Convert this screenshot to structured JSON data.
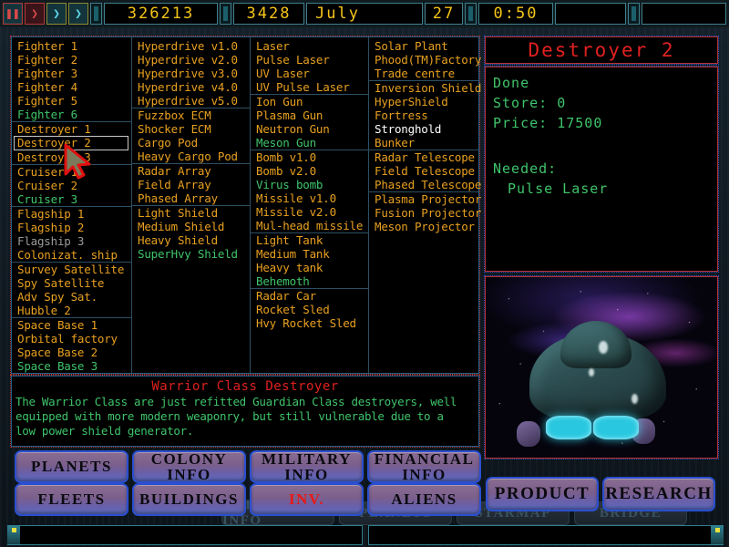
{
  "topbar": {
    "controls": [
      {
        "name": "pause-button",
        "glyph": "❚❚",
        "style": "ctl-pause"
      },
      {
        "name": "play-button",
        "glyph": "❯",
        "style": "ctl-play"
      },
      {
        "name": "fast-forward-button",
        "glyph": "❯",
        "style": "ctl-ff"
      },
      {
        "name": "fastest-forward-button",
        "glyph": "❯",
        "style": "ctl-ff"
      }
    ],
    "money": "326213",
    "research": "3428",
    "month": "July",
    "day": "27",
    "time": "0:50"
  },
  "inventory": {
    "columns": [
      {
        "name": "ships",
        "items": [
          {
            "label": "Fighter 1",
            "state": "available"
          },
          {
            "label": "Fighter 2",
            "state": "available"
          },
          {
            "label": "Fighter 3",
            "state": "available"
          },
          {
            "label": "Fighter 4",
            "state": "available"
          },
          {
            "label": "Fighter 5",
            "state": "available"
          },
          {
            "label": "Fighter 6",
            "state": "new"
          },
          {
            "label": "Destroyer 1",
            "state": "available",
            "group_start": true
          },
          {
            "label": "Destroyer 2",
            "state": "available",
            "selected": true
          },
          {
            "label": "Destroyer 3",
            "state": "available"
          },
          {
            "label": "Cruiser 1",
            "state": "available",
            "group_start": true
          },
          {
            "label": "Cruiser 2",
            "state": "available"
          },
          {
            "label": "Cruiser 3",
            "state": "new"
          },
          {
            "label": "Flagship 1",
            "state": "available",
            "group_start": true
          },
          {
            "label": "Flagship 2",
            "state": "available"
          },
          {
            "label": "Flagship 3",
            "state": "locked"
          },
          {
            "label": "Colonizat. ship",
            "state": "available"
          },
          {
            "label": "Survey Satellite",
            "state": "available",
            "group_start": true
          },
          {
            "label": "Spy Satellite",
            "state": "available"
          },
          {
            "label": "Adv Spy Sat.",
            "state": "available"
          },
          {
            "label": "Hubble 2",
            "state": "available"
          },
          {
            "label": "Space Base 1",
            "state": "available",
            "group_start": true
          },
          {
            "label": "Orbital factory",
            "state": "available"
          },
          {
            "label": "Space Base 2",
            "state": "available"
          },
          {
            "label": "Space Base 3",
            "state": "new"
          }
        ]
      },
      {
        "name": "ship-systems",
        "items": [
          {
            "label": "Hyperdrive v1.0",
            "state": "available"
          },
          {
            "label": "Hyperdrive v2.0",
            "state": "available"
          },
          {
            "label": "Hyperdrive v3.0",
            "state": "available"
          },
          {
            "label": "Hyperdrive v4.0",
            "state": "available"
          },
          {
            "label": "Hyperdrive v5.0",
            "state": "available"
          },
          {
            "label": "Fuzzbox ECM",
            "state": "available",
            "group_start": true
          },
          {
            "label": "Shocker ECM",
            "state": "available"
          },
          {
            "label": "Cargo Pod",
            "state": "available"
          },
          {
            "label": "Heavy Cargo Pod",
            "state": "available"
          },
          {
            "label": "Radar Array",
            "state": "available",
            "group_start": true
          },
          {
            "label": "Field Array",
            "state": "available"
          },
          {
            "label": "Phased Array",
            "state": "available"
          },
          {
            "label": "Light Shield",
            "state": "available",
            "group_start": true
          },
          {
            "label": "Medium Shield",
            "state": "available"
          },
          {
            "label": "Heavy Shield",
            "state": "available"
          },
          {
            "label": "SuperHvy Shield",
            "state": "new"
          }
        ]
      },
      {
        "name": "weapons",
        "items": [
          {
            "label": "Laser",
            "state": "available"
          },
          {
            "label": "Pulse Laser",
            "state": "available"
          },
          {
            "label": "UV Laser",
            "state": "available"
          },
          {
            "label": "UV Pulse Laser",
            "state": "available"
          },
          {
            "label": "Ion Gun",
            "state": "available",
            "group_start": true
          },
          {
            "label": "Plasma Gun",
            "state": "available"
          },
          {
            "label": "Neutron Gun",
            "state": "available"
          },
          {
            "label": "Meson Gun",
            "state": "new"
          },
          {
            "label": "Bomb v1.0",
            "state": "available",
            "group_start": true
          },
          {
            "label": "Bomb v2.0",
            "state": "available"
          },
          {
            "label": "Virus bomb",
            "state": "new"
          },
          {
            "label": "Missile v1.0",
            "state": "available"
          },
          {
            "label": "Missile v2.0",
            "state": "available"
          },
          {
            "label": "Mul-head missile",
            "state": "available"
          },
          {
            "label": "Light Tank",
            "state": "available",
            "group_start": true
          },
          {
            "label": "Medium Tank",
            "state": "available"
          },
          {
            "label": "Heavy tank",
            "state": "available"
          },
          {
            "label": "Behemoth",
            "state": "new"
          },
          {
            "label": "Radar Car",
            "state": "available",
            "group_start": true
          },
          {
            "label": "Rocket Sled",
            "state": "available"
          },
          {
            "label": "Hvy Rocket Sled",
            "state": "available"
          }
        ]
      },
      {
        "name": "buildings",
        "items": [
          {
            "label": "Solar Plant",
            "state": "available"
          },
          {
            "label": "Phood(TM)Factory",
            "state": "available"
          },
          {
            "label": "Trade centre",
            "state": "available"
          },
          {
            "label": "Inversion Shield",
            "state": "available",
            "group_start": true
          },
          {
            "label": "HyperShield",
            "state": "available"
          },
          {
            "label": "Fortress",
            "state": "available"
          },
          {
            "label": "Stronghold",
            "state": "highlighted"
          },
          {
            "label": "Bunker",
            "state": "available"
          },
          {
            "label": "Radar Telescope",
            "state": "available",
            "group_start": true
          },
          {
            "label": "Field Telescope",
            "state": "available"
          },
          {
            "label": "Phased Telescope",
            "state": "available"
          },
          {
            "label": "Plasma Projector",
            "state": "available",
            "group_start": true
          },
          {
            "label": "Fusion Projector",
            "state": "available"
          },
          {
            "label": "Meson Projector",
            "state": "available"
          }
        ]
      }
    ]
  },
  "description": {
    "title": "Warrior Class Destroyer",
    "line1": "The Warrior Class are just refitted Guardian Class destroyers, well",
    "line2": "equipped with more modern weaponry, but still vulnerable due to a",
    "line3": "low power shield generator."
  },
  "detail": {
    "title": "Destroyer 2",
    "status": "Done",
    "store": "Store: 0",
    "price": "Price: 17500",
    "needed_label": "Needed:",
    "needed_item": "Pulse Laser"
  },
  "nav": {
    "row1": [
      {
        "name": "planets-button",
        "label": "PLANETS",
        "label2": ""
      },
      {
        "name": "colony-info-button",
        "label": "COLONY",
        "label2": "INFO"
      },
      {
        "name": "military-info-button",
        "label": "MILITARY",
        "label2": "INFO"
      },
      {
        "name": "financial-info-button",
        "label": "FINANCIAL",
        "label2": "INFO"
      }
    ],
    "row2": [
      {
        "name": "fleets-button",
        "label": "FLEETS",
        "label2": ""
      },
      {
        "name": "buildings-button",
        "label": "BUILDINGS",
        "label2": ""
      },
      {
        "name": "inventory-button",
        "label": "INV.",
        "label2": "",
        "active": true
      },
      {
        "name": "aliens-button",
        "label": "ALIENS",
        "label2": ""
      }
    ],
    "right": [
      {
        "name": "product-button",
        "label": "PRODUCT"
      },
      {
        "name": "research-button",
        "label": "RESEARCH"
      }
    ],
    "background_row": [
      {
        "name": "bg-colony-info-button",
        "label": "COLONY INFO"
      },
      {
        "name": "bg-planets-button",
        "label": "PLANETS"
      },
      {
        "name": "bg-starmap-button",
        "label": "STARMAP"
      },
      {
        "name": "bg-bridge-button",
        "label": "BRIDGE"
      }
    ]
  },
  "colors": {
    "available": "#e8a020",
    "new": "#3fc46a",
    "locked": "#9a9a9a",
    "highlighted": "#ffffff",
    "title_red": "#e02020",
    "lcd_yellow": "#f5c518",
    "panel_border": "#1e5f88"
  }
}
